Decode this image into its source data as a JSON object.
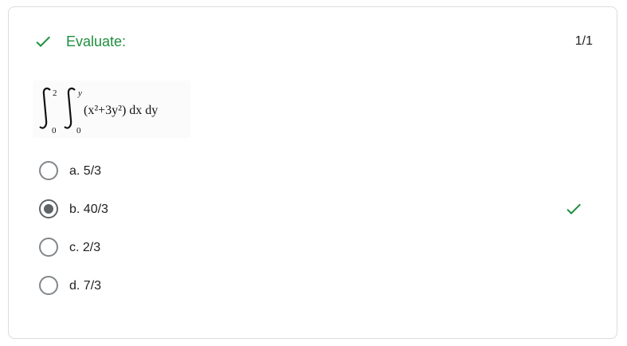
{
  "question": {
    "title": "Evaluate:",
    "score": "1/1",
    "status_icon": "check-icon",
    "formula": {
      "outer_lower": "0",
      "outer_upper": "2",
      "inner_lower": "0",
      "inner_upper": "y",
      "integrand": "(x²+3y²) dx dy"
    }
  },
  "options": [
    {
      "label": "a. 5/3",
      "selected": false,
      "correct": false
    },
    {
      "label": "b. 40/3",
      "selected": true,
      "correct": true
    },
    {
      "label": "c. 2/3",
      "selected": false,
      "correct": false
    },
    {
      "label": "d. 7/3",
      "selected": false,
      "correct": false
    }
  ],
  "colors": {
    "correct": "#1e8e3e",
    "radio": "#5f6368",
    "text": "#202124",
    "border": "#dadce0"
  }
}
